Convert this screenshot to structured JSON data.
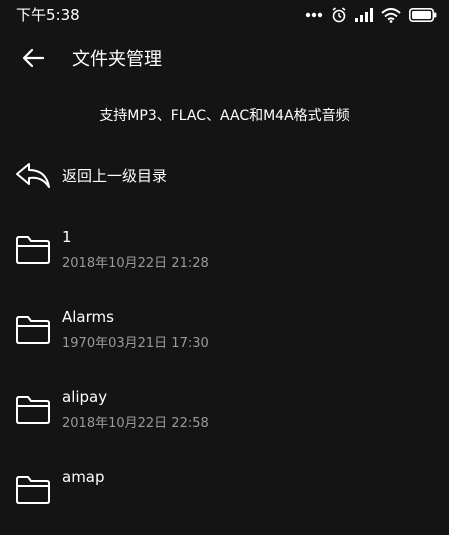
{
  "status_bar": {
    "time": "下午5:38",
    "icons": [
      "more-dots-icon",
      "alarm-icon",
      "signal-icon",
      "wifi-icon",
      "battery-icon"
    ]
  },
  "app_bar": {
    "title": "文件夹管理",
    "back_icon": "arrow-left-icon"
  },
  "hint": "支持MP3、FLAC、AAC和M4A格式音频",
  "up_level": {
    "label": "返回上一级目录",
    "icon": "undo-arrow-icon"
  },
  "folders": [
    {
      "name": "1",
      "date": "2018年10月22日 21:28"
    },
    {
      "name": "Alarms",
      "date": "1970年03月21日 17:30"
    },
    {
      "name": "alipay",
      "date": "2018年10月22日 22:58"
    },
    {
      "name": "amap",
      "date": ""
    }
  ],
  "colors": {
    "background": "#141414",
    "text_primary": "#ffffff",
    "text_secondary": "#9a9a9a"
  }
}
